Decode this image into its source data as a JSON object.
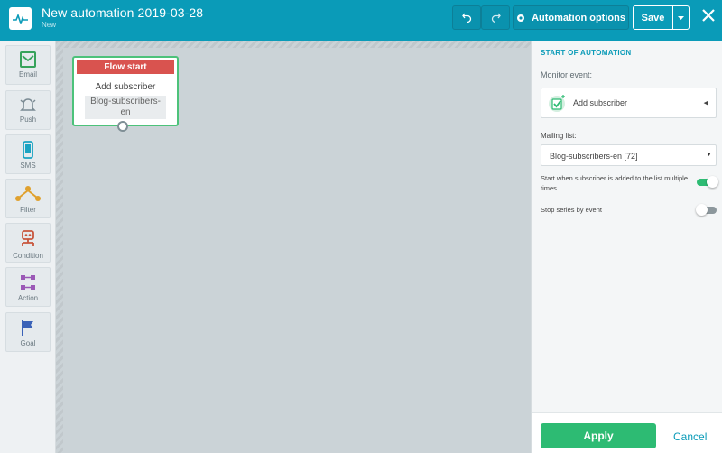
{
  "header": {
    "title": "New automation 2019-03-28",
    "status": "New",
    "automation_options_label": "Automation options",
    "save_label": "Save"
  },
  "toolbox": {
    "items": [
      {
        "label": "Email",
        "icon": "email-icon",
        "color": "#37a35b"
      },
      {
        "label": "Push",
        "icon": "bell-icon",
        "color": "#7a8a93"
      },
      {
        "label": "SMS",
        "icon": "phone-icon",
        "color": "#1aa3c2"
      },
      {
        "label": "Filter",
        "icon": "filter-icon",
        "color": "#e0a12e"
      },
      {
        "label": "Condition",
        "icon": "condition-icon",
        "color": "#c8553d"
      },
      {
        "label": "Action",
        "icon": "action-icon",
        "color": "#9b59b6"
      },
      {
        "label": "Goal",
        "icon": "flag-icon",
        "color": "#3a62b8"
      }
    ]
  },
  "flow_node": {
    "header": "Flow start",
    "event": "Add subscriber",
    "list": "Blog-subscribers-en"
  },
  "panel": {
    "title": "START OF AUTOMATION",
    "monitor_label": "Monitor event:",
    "event_value": "Add subscriber",
    "mailing_label": "Mailing list:",
    "mailing_value": "Blog-subscribers-en [72]",
    "options": [
      {
        "label": "Start when subscriber is added to the list multiple times",
        "enabled": true
      },
      {
        "label": "Stop series by event",
        "enabled": false
      }
    ],
    "apply_label": "Apply",
    "cancel_label": "Cancel"
  },
  "colors": {
    "brand": "#0a9bb8",
    "success": "#2dbb73",
    "danger": "#d9534f",
    "toggle_on": "#2dbb73",
    "toggle_off": "#8c979c"
  }
}
